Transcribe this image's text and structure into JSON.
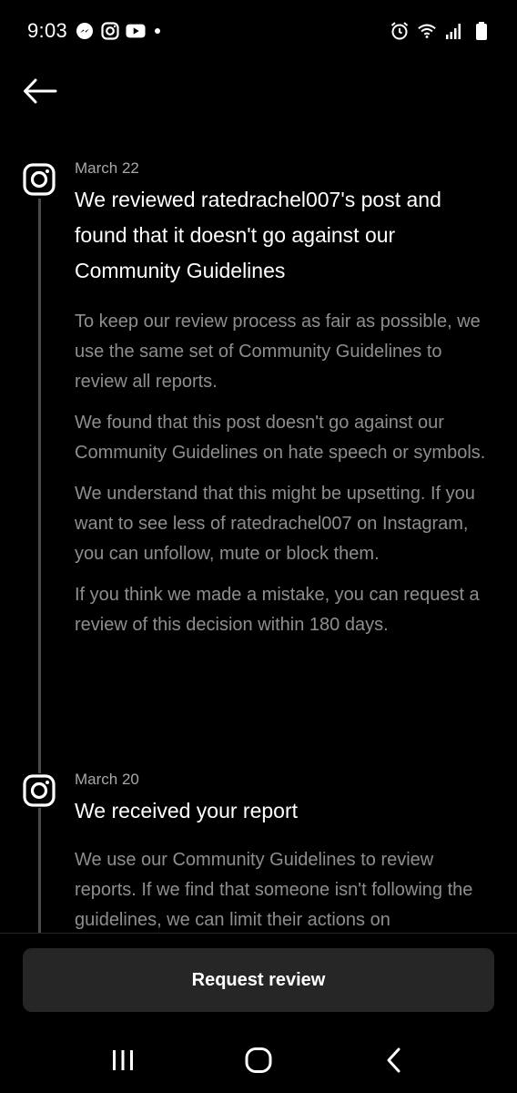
{
  "status_bar": {
    "time": "9:03",
    "left_icons": [
      "messenger-icon",
      "instagram-icon",
      "youtube-icon",
      "dot-icon"
    ],
    "right_icons": [
      "alarm-icon",
      "wifi-icon",
      "signal-icon",
      "battery-icon"
    ]
  },
  "timeline": [
    {
      "date": "March 22",
      "title": "We reviewed ratedrachel007's post and found that it doesn't go against our Community Guidelines",
      "paragraphs": [
        "To keep our review process as fair as possible, we use the same set of Community Guidelines to review all reports.",
        "We found that this post doesn't go against our Community Guidelines on hate speech or symbols.",
        "We understand that this might be upsetting. If you want to see less of ratedrachel007 on Instagram, you can unfollow, mute or block them.",
        "If you think we made a mistake, you can request a review of this decision within 180 days."
      ]
    },
    {
      "date": "March 20",
      "title": "We received your report",
      "paragraphs": [
        "We use our Community Guidelines to review reports. If we find that someone isn't following the guidelines, we can limit their actions on"
      ]
    }
  ],
  "bottom": {
    "request_review_label": "Request review"
  },
  "colors": {
    "background": "#000000",
    "title_text": "#ffffff",
    "body_text": "#8e8e8e",
    "date_text": "#a8a8a8",
    "button_bg": "#262626"
  }
}
